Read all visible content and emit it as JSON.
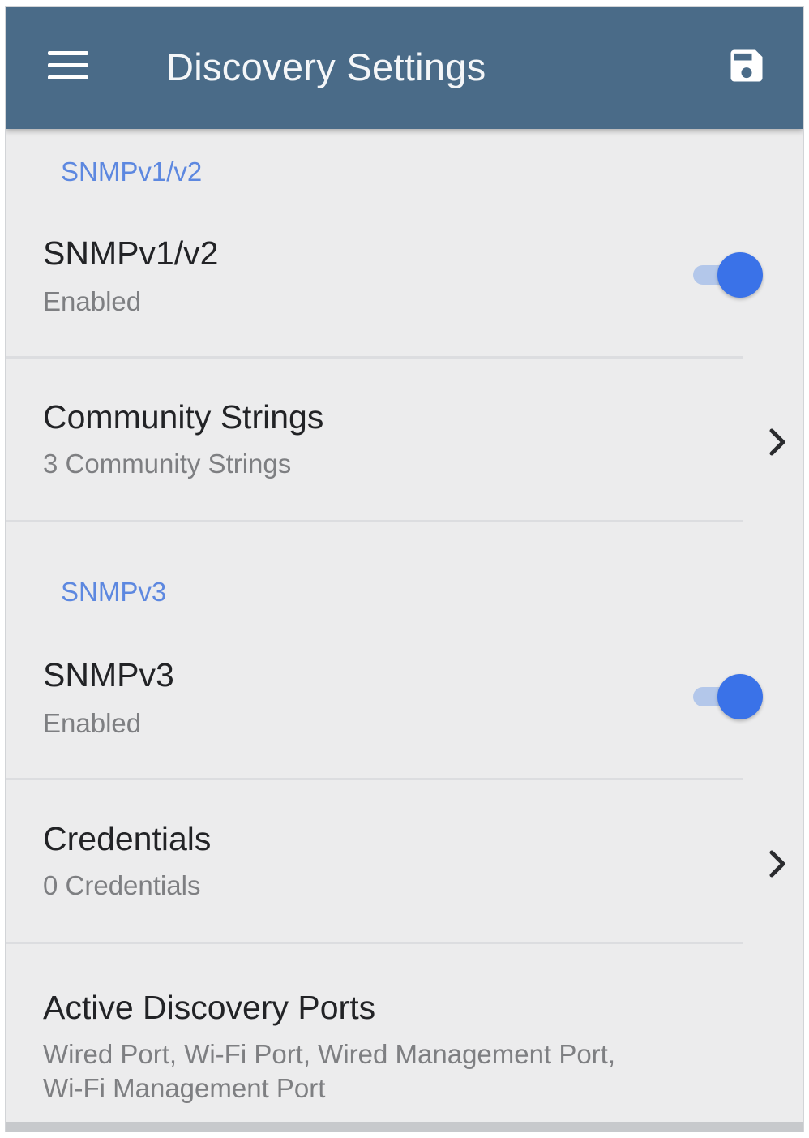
{
  "app_bar": {
    "title": "Discovery Settings",
    "menu_icon": "hamburger-menu-icon",
    "save_icon": "floppy-disk-save-icon"
  },
  "sections": {
    "snmp_v1v2": {
      "header": "SNMPv1/v2",
      "toggle_row": {
        "title": "SNMPv1/v2",
        "subtitle": "Enabled",
        "enabled": true
      },
      "community_strings": {
        "title": "Community Strings",
        "subtitle": "3 Community Strings"
      }
    },
    "snmp_v3": {
      "header": "SNMPv3",
      "toggle_row": {
        "title": "SNMPv3",
        "subtitle": "Enabled",
        "enabled": true
      },
      "credentials": {
        "title": "Credentials",
        "subtitle": "0 Credentials"
      }
    },
    "active_discovery_ports": {
      "title": "Active Discovery Ports",
      "subtitle_line1": "Wired Port, Wi-Fi Port, Wired Management Port,",
      "subtitle_line2": "Wi-Fi Management Port"
    }
  },
  "colors": {
    "app_bar": "#4a6b88",
    "accent": "#3a72e8",
    "section_header": "#5d88e0",
    "background": "#ececed"
  }
}
